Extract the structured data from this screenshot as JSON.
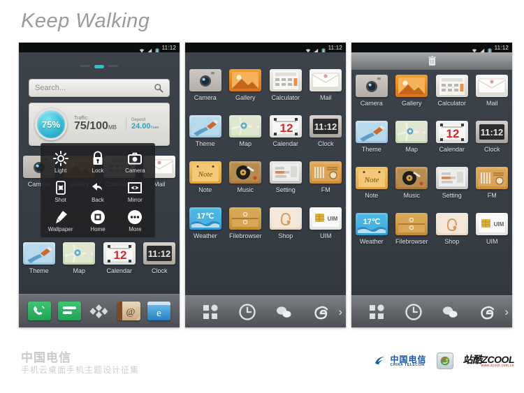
{
  "page": {
    "title": "Keep Walking",
    "background": "#ffffff"
  },
  "status_bar": {
    "time": "11:12",
    "icons": [
      "wifi-icon",
      "signal-icon",
      "battery-icon"
    ]
  },
  "screen1": {
    "page_dots": {
      "count": 3,
      "active_index": 1,
      "active_color": "#25c6c6"
    },
    "search": {
      "placeholder": "Search...",
      "icon": "search-icon"
    },
    "widget": {
      "percent": "75%",
      "traffic_label": "Traffic:",
      "traffic_value": "75/100",
      "traffic_unit": "MB",
      "deposit_label": "Deposit",
      "deposit_value": "24.00",
      "deposit_unit": "Yuan",
      "accent": "#2aa3b8"
    },
    "hidden_row": [
      {
        "label": "Camera",
        "icon": "camera-icon"
      },
      {
        "label": "Gallery",
        "icon": "gallery-icon"
      },
      {
        "label": "Calculator",
        "icon": "calculator-icon"
      },
      {
        "label": "Mail",
        "icon": "mail-icon"
      }
    ],
    "apps_row": [
      {
        "label": "Theme",
        "icon": "theme-icon"
      },
      {
        "label": "Map",
        "icon": "map-icon"
      },
      {
        "label": "Calendar",
        "icon": "calendar-icon"
      },
      {
        "label": "Clock",
        "icon": "clock-icon"
      }
    ],
    "popup": {
      "items": [
        {
          "label": "Light",
          "icon": "brightness-icon"
        },
        {
          "label": "Lock",
          "icon": "lock-icon"
        },
        {
          "label": "Camera",
          "icon": "camera-icon"
        },
        {
          "label": "Shot",
          "icon": "screenshot-icon"
        },
        {
          "label": "Back",
          "icon": "back-arrow-icon"
        },
        {
          "label": "Mirror",
          "icon": "eye-mirror-icon"
        },
        {
          "label": "Wallpaper",
          "icon": "brush-icon"
        },
        {
          "label": "Home",
          "icon": "home-square-icon"
        },
        {
          "label": "More",
          "icon": "more-dots-icon"
        }
      ]
    },
    "dock": [
      {
        "label": "Phone",
        "icon": "phone-icon"
      },
      {
        "label": "Messages",
        "icon": "sms-icon"
      },
      {
        "label": "AppDrawer",
        "icon": "app-drawer-diamond-icon"
      },
      {
        "label": "Mail",
        "icon": "at-mail-icon"
      },
      {
        "label": "Browser",
        "icon": "browser-e-icon"
      }
    ]
  },
  "screen2": {
    "apps": [
      {
        "label": "Camera",
        "icon": "camera-icon"
      },
      {
        "label": "Gallery",
        "icon": "gallery-icon"
      },
      {
        "label": "Calculator",
        "icon": "calculator-icon"
      },
      {
        "label": "Mail",
        "icon": "mail-icon"
      },
      {
        "label": "Theme",
        "icon": "theme-icon"
      },
      {
        "label": "Map",
        "icon": "map-icon"
      },
      {
        "label": "Calendar",
        "icon": "calendar-icon"
      },
      {
        "label": "Clock",
        "icon": "clock-icon"
      },
      {
        "label": "Note",
        "icon": "note-icon"
      },
      {
        "label": "Music",
        "icon": "music-icon"
      },
      {
        "label": "Setting",
        "icon": "setting-icon"
      },
      {
        "label": "FM",
        "icon": "fm-radio-icon"
      },
      {
        "label": "Weather",
        "icon": "weather-icon"
      },
      {
        "label": "Filebrowser",
        "icon": "filebrowser-icon"
      },
      {
        "label": "Shop",
        "icon": "shop-icon"
      },
      {
        "label": "UIM",
        "icon": "uim-card-icon"
      }
    ],
    "icon_text": {
      "weather": "17",
      "weather_unit": "℃",
      "note": "Note",
      "uim": "UIM",
      "calendar": "12",
      "clock": "11:12"
    },
    "navbar": [
      {
        "icon": "grid-icon"
      },
      {
        "icon": "clock-icon"
      },
      {
        "icon": "chat-bubbles-icon"
      },
      {
        "icon": "swirl-e-icon"
      }
    ],
    "navbar_chevron": "›"
  },
  "screen3": {
    "trash": {
      "icon": "trash-can-icon"
    },
    "apps": [
      {
        "label": "Camera",
        "icon": "camera-icon"
      },
      {
        "label": "Gallery",
        "icon": "gallery-icon"
      },
      {
        "label": "Calculator",
        "icon": "calculator-icon"
      },
      {
        "label": "Mail",
        "icon": "mail-icon"
      },
      {
        "label": "Theme",
        "icon": "theme-icon"
      },
      {
        "label": "Map",
        "icon": "map-icon"
      },
      {
        "label": "Calendar",
        "icon": "calendar-icon"
      },
      {
        "label": "Clock",
        "icon": "clock-icon"
      },
      {
        "label": "Note",
        "icon": "note-icon"
      },
      {
        "label": "Music",
        "icon": "music-icon"
      },
      {
        "label": "Setting",
        "icon": "setting-icon"
      },
      {
        "label": "FM",
        "icon": "fm-radio-icon"
      },
      {
        "label": "Weather",
        "icon": "weather-icon"
      },
      {
        "label": "Filebrowser",
        "icon": "filebrowser-icon"
      },
      {
        "label": "Shop",
        "icon": "shop-icon"
      },
      {
        "label": "UIM",
        "icon": "uim-card-icon"
      }
    ],
    "navbar_chevron": "›"
  },
  "footer": {
    "brand_cn": "中国电信",
    "subtitle": "手机云桌面手机主题设计征集",
    "logos": {
      "china_telecom_cn": "中国电信",
      "china_telecom_en": "CHINA TELECOM",
      "zcool_main": "站酷ZCOOL",
      "zcool_url": "www.zcool.com.cn"
    }
  }
}
